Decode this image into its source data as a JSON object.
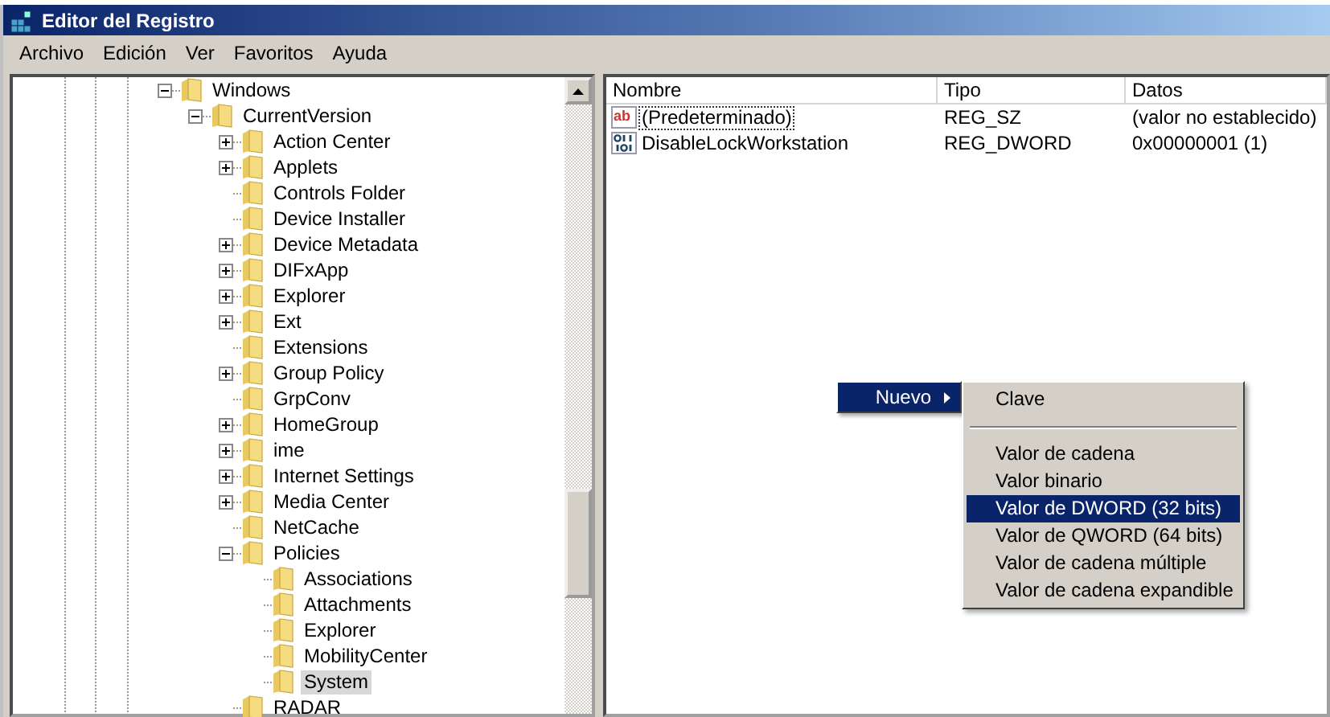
{
  "window": {
    "title": "Editor del Registro"
  },
  "menu": [
    "Archivo",
    "Edición",
    "Ver",
    "Favoritos",
    "Ayuda"
  ],
  "tree": [
    {
      "label": "Windows",
      "expanded": true,
      "selected": false,
      "children": [
        {
          "label": "CurrentVersion",
          "expanded": true,
          "selected": false,
          "children": [
            {
              "label": "Action Center",
              "expanded": false,
              "selected": false
            },
            {
              "label": "Applets",
              "expanded": false,
              "selected": false
            },
            {
              "label": "Controls Folder",
              "selected": false
            },
            {
              "label": "Device Installer",
              "selected": false
            },
            {
              "label": "Device Metadata",
              "expanded": false,
              "selected": false
            },
            {
              "label": "DIFxApp",
              "expanded": false,
              "selected": false
            },
            {
              "label": "Explorer",
              "expanded": false,
              "selected": false
            },
            {
              "label": "Ext",
              "expanded": false,
              "selected": false
            },
            {
              "label": "Extensions",
              "selected": false
            },
            {
              "label": "Group Policy",
              "expanded": false,
              "selected": false
            },
            {
              "label": "GrpConv",
              "selected": false
            },
            {
              "label": "HomeGroup",
              "expanded": false,
              "selected": false
            },
            {
              "label": "ime",
              "expanded": false,
              "selected": false
            },
            {
              "label": "Internet Settings",
              "expanded": false,
              "selected": false
            },
            {
              "label": "Media Center",
              "expanded": false,
              "selected": false
            },
            {
              "label": "NetCache",
              "selected": false
            },
            {
              "label": "Policies",
              "expanded": true,
              "selected": false,
              "children": [
                {
                  "label": "Associations",
                  "selected": false
                },
                {
                  "label": "Attachments",
                  "selected": false
                },
                {
                  "label": "Explorer",
                  "selected": false
                },
                {
                  "label": "MobilityCenter",
                  "selected": false
                },
                {
                  "label": "System",
                  "selected": true
                }
              ]
            },
            {
              "label": "RADAR",
              "selected": false
            }
          ]
        }
      ]
    }
  ],
  "values": {
    "columns": [
      "Nombre",
      "Tipo",
      "Datos"
    ],
    "rows": [
      {
        "kind": "string",
        "icon_text": "ab",
        "name": "(Predeterminado)",
        "type": "REG_SZ",
        "data": "(valor no establecido)",
        "focused": true
      },
      {
        "kind": "binary",
        "name": "DisableLockWorkstation",
        "type": "REG_DWORD",
        "data": "0x00000001 (1)",
        "focused": false
      }
    ]
  },
  "context_menu": {
    "label": "Nuevo",
    "selected": true,
    "submenu": [
      {
        "kind": "item",
        "label": "Clave",
        "selected": false
      },
      {
        "kind": "separator"
      },
      {
        "kind": "item",
        "label": "Valor de cadena",
        "selected": false
      },
      {
        "kind": "item",
        "label": "Valor binario",
        "selected": false
      },
      {
        "kind": "item",
        "label": "Valor de DWORD (32 bits)",
        "selected": true
      },
      {
        "kind": "item",
        "label": "Valor de QWORD (64 bits)",
        "selected": false
      },
      {
        "kind": "item",
        "label": "Valor de cadena múltiple",
        "selected": false
      },
      {
        "kind": "item",
        "label": "Valor de cadena expandible",
        "selected": false
      }
    ]
  }
}
